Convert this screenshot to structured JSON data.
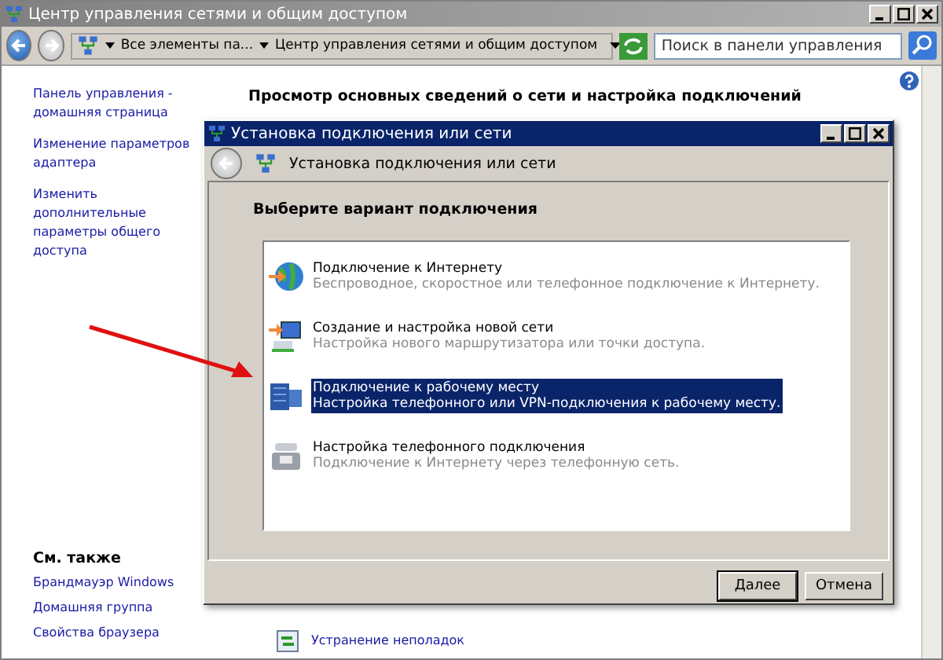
{
  "window": {
    "title": "Центр управления сетями и общим доступом"
  },
  "address_bar": {
    "crumbs": [
      "Все элементы па...",
      "Центр управления сетями и общим доступом"
    ]
  },
  "search": {
    "placeholder": "Поиск в панели управления"
  },
  "sidebar": {
    "links": [
      "Панель управления - домашняя страница",
      "Изменение параметров адаптера",
      "Изменить дополнительные параметры общего доступа"
    ],
    "see_also_title": "См. также",
    "see_also": [
      "Брандмауэр Windows",
      "Домашняя группа",
      "Свойства браузера"
    ]
  },
  "main": {
    "heading": "Просмотр основных сведений о сети и настройка подключений",
    "troubleshoot_link": "Устранение неполадок"
  },
  "dialog": {
    "title": "Установка подключения или сети",
    "header": "Установка подключения или сети",
    "prompt": "Выберите вариант подключения",
    "options": [
      {
        "kind": "internet",
        "title": "Подключение к Интернету",
        "description": "Беспроводное, скоростное или телефонное подключение к Интернету.",
        "selected": false
      },
      {
        "kind": "network",
        "title": "Создание и настройка новой сети",
        "description": "Настройка нового маршрутизатора или точки доступа.",
        "selected": false
      },
      {
        "kind": "workplace",
        "title": "Подключение к рабочему месту",
        "description": "Настройка телефонного или VPN-подключения к рабочему месту.",
        "selected": true
      },
      {
        "kind": "dialup",
        "title": "Настройка телефонного подключения",
        "description": "Подключение к Интернету через телефонную сеть.",
        "selected": false
      }
    ],
    "buttons": [
      "Далее",
      "Отмена"
    ]
  }
}
